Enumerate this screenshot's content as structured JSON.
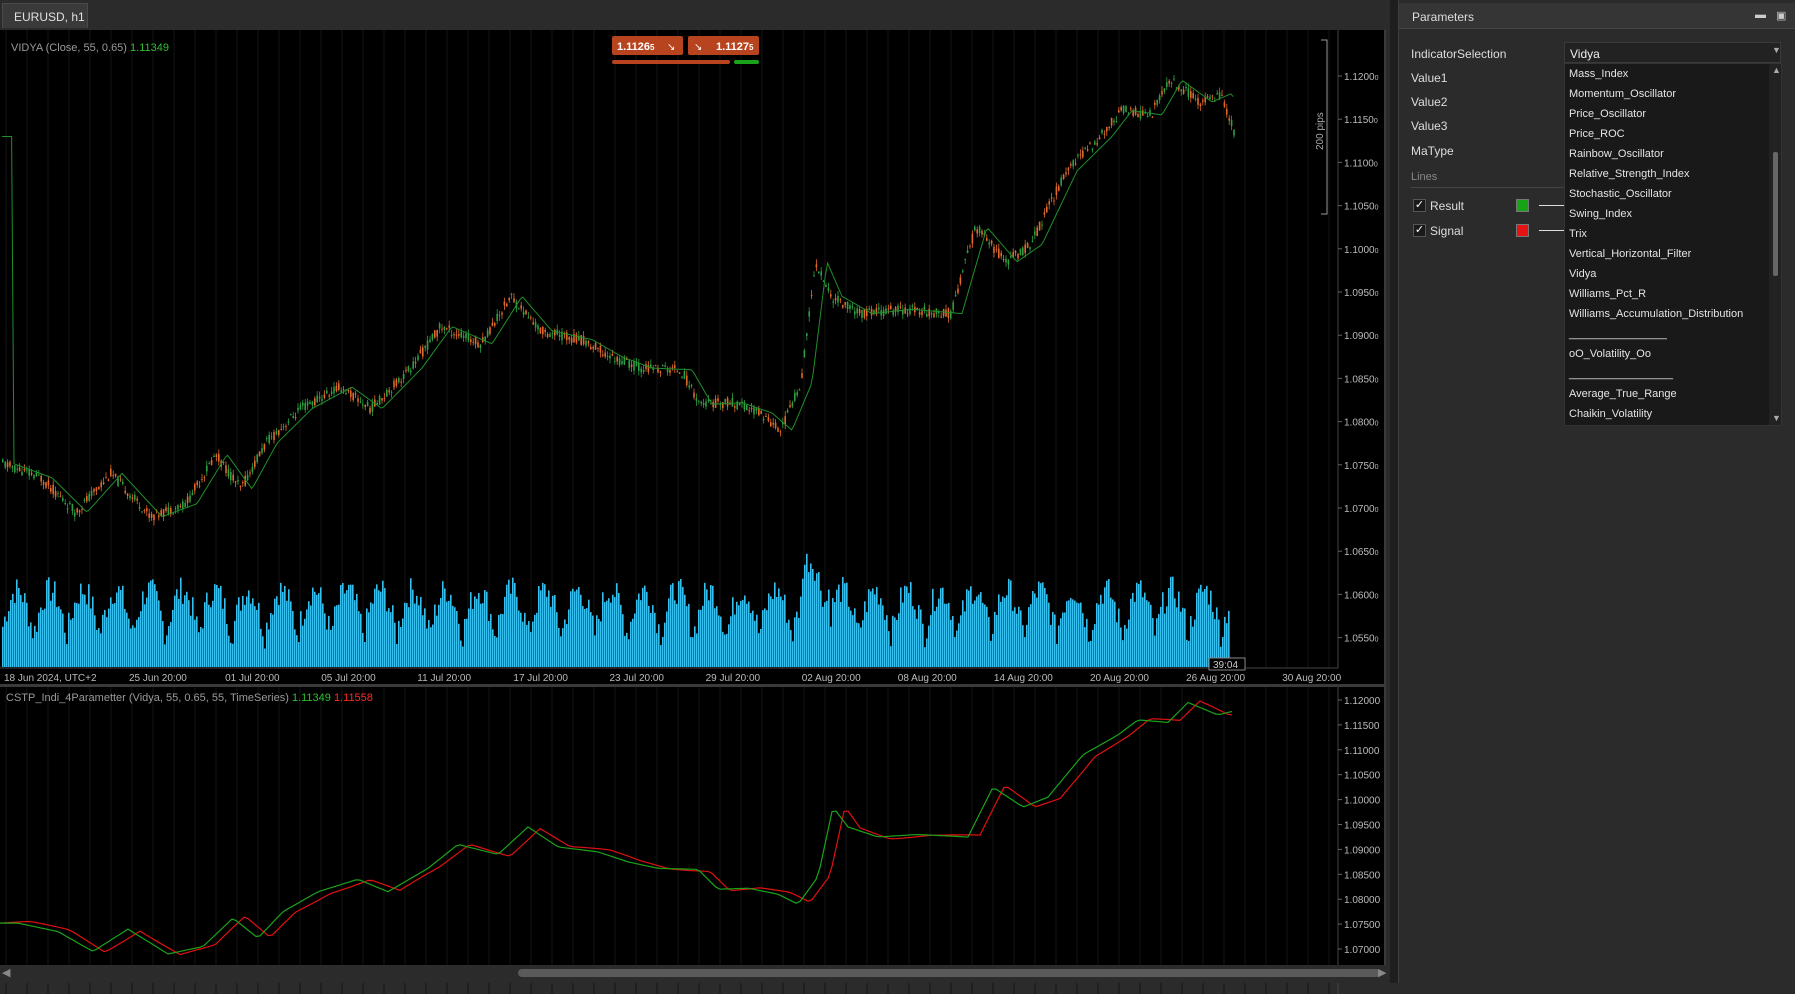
{
  "window": {
    "tab_title": "EURUSD, h1"
  },
  "main_chart": {
    "indicator_legend": "VIDYA (Close, 55, 0.65)",
    "indicator_value": "1.11349",
    "sell_price": "1.1126",
    "sell_price_small": "5",
    "buy_price": "1.1127",
    "buy_price_small": "5",
    "range_label": "200 pips",
    "timer": "39:04",
    "price_axis": [
      "1.1200",
      "1.1150",
      "1.1100",
      "1.1050",
      "1.1000",
      "1.0950",
      "1.0900",
      "1.0850",
      "1.0800",
      "1.0750",
      "1.0700",
      "1.0650",
      "1.0600",
      "1.0550"
    ],
    "price_axis_small": "0",
    "time_axis": [
      "18 Jun 2024, UTC+2",
      "25 Jun 20:00",
      "01 Jul 20:00",
      "05 Jul 20:00",
      "11 Jul 20:00",
      "17 Jul 20:00",
      "23 Jul 20:00",
      "29 Jul 20:00",
      "02 Aug 20:00",
      "08 Aug 20:00",
      "14 Aug 20:00",
      "20 Aug 20:00",
      "26 Aug 20:00",
      "30 Aug 20:00"
    ]
  },
  "sub_chart": {
    "legend": "CSTP_Indi_4Parametter (Vidya, 55, 0.65, 55, TimeSeries)",
    "result_value": "1.11349",
    "signal_value": "1.11558",
    "price_axis": [
      "1.12000",
      "1.11500",
      "1.11000",
      "1.10500",
      "1.10000",
      "1.09500",
      "1.09000",
      "1.08500",
      "1.08000",
      "1.07500",
      "1.07000"
    ]
  },
  "colors": {
    "candle_up": "#2ea043",
    "candle_down": "#e0692c",
    "indicator": "#1f8f2a",
    "volume": "#36c0f0",
    "result_line": "#1aa31a",
    "signal_line": "#e01010",
    "sell_button": "#b8431f",
    "buy_button": "#b8431f"
  },
  "panel": {
    "title": "Parameters",
    "min_icon": "minimize-icon",
    "save_icon": "save-icon",
    "params": [
      {
        "label": "IndicatorSelection"
      },
      {
        "label": "Value1"
      },
      {
        "label": "Value2"
      },
      {
        "label": "Value3"
      },
      {
        "label": "MaType"
      }
    ],
    "selected_indicator": "Vidya",
    "lines_header": "Lines",
    "lines": [
      {
        "label": "Result",
        "checked": "✓",
        "color": "#17a317"
      },
      {
        "label": "Signal",
        "checked": "✓",
        "color": "#e51414"
      }
    ],
    "dropdown_options": [
      "Mass_Index",
      "Momentum_Oscillator",
      "Price_Oscillator",
      "Price_ROC",
      "Rainbow_Oscillator",
      "Relative_Strength_Index",
      "Stochastic_Oscillator",
      "Swing_Index",
      "Trix",
      "Vertical_Horizontal_Filter",
      "Vidya",
      "Williams_Pct_R",
      "Williams_Accumulation_Distribution",
      "________________",
      "oO_Volatility_Oo",
      "_________________",
      "Average_True_Range",
      "Chaikin_Volatility"
    ]
  }
}
